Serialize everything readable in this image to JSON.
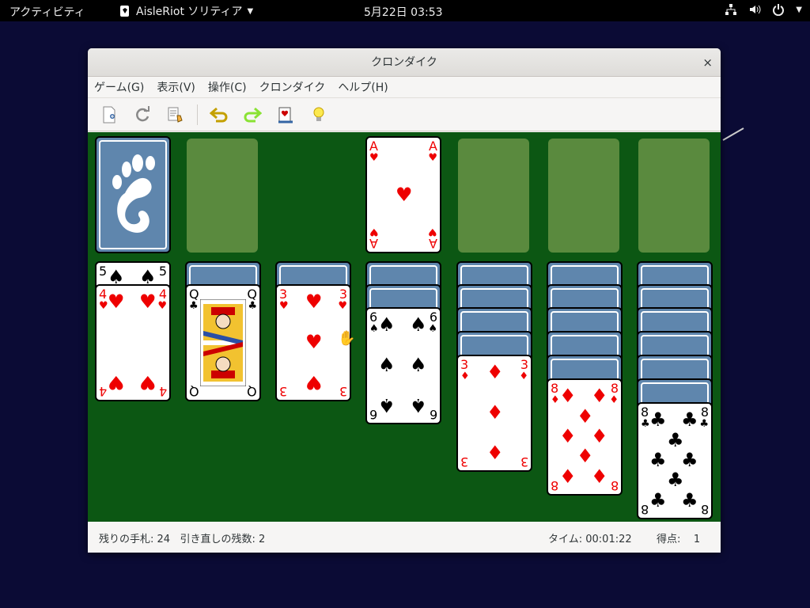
{
  "topbar": {
    "activities": "アクティビティ",
    "app_name": "AisleRiot ソリティア",
    "clock": "5月22日  03:53"
  },
  "window": {
    "title": "クロンダイク",
    "close": "×",
    "menus": [
      "ゲーム(G)",
      "表示(V)",
      "操作(C)",
      "クロンダイク",
      "ヘルプ(H)"
    ],
    "toolbar_icons": [
      "new-game-icon",
      "restart-icon",
      "select-game-icon",
      "undo-icon",
      "redo-icon",
      "deal-icon",
      "hint-icon"
    ]
  },
  "status": {
    "stock": "残りの手札: 24",
    "redeals": "引き直しの残数: 2",
    "time": "タイム: 00:01:22",
    "score": "得点:    1"
  },
  "cards": {
    "foundation_heart_A": "A",
    "c1_top": "5",
    "c1_face": "4",
    "c2_face": "Q",
    "c3_face": "3",
    "c4_face": "6",
    "c5_face": "3",
    "c6_face": "8",
    "c7_face": "8"
  },
  "colors": {
    "felt": "#0c5713",
    "slot": "#5a8a3e",
    "card_back": "#5f86ad",
    "red_suit": "#e00000"
  }
}
